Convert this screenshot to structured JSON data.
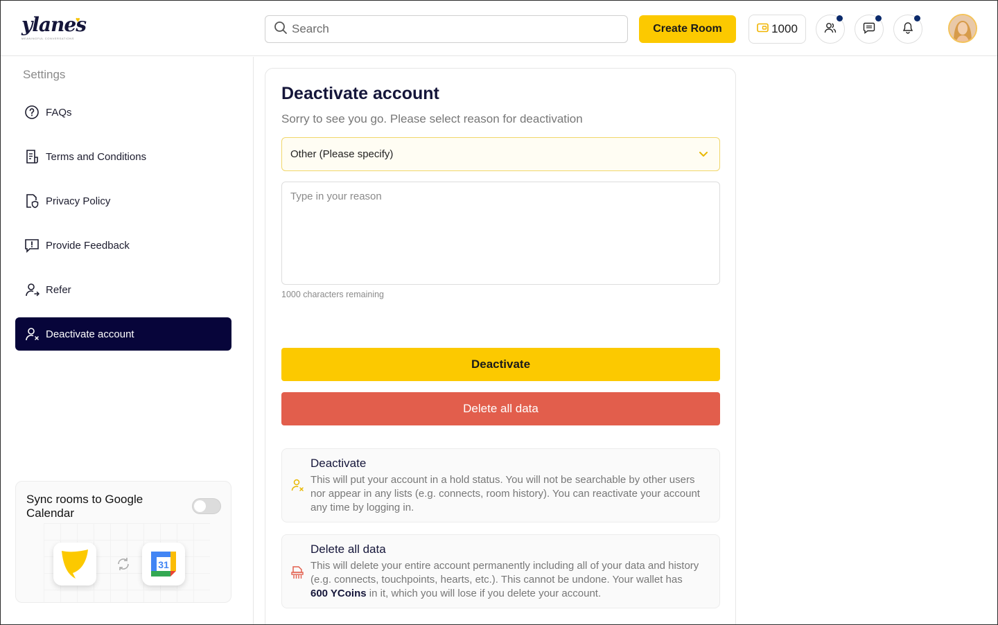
{
  "brand": {
    "name": "ylanes",
    "tagline": "MEANINGFUL CONVERSATIONS",
    "accent": "#fcc900",
    "dark": "#07053a",
    "danger": "#e25e4c"
  },
  "header": {
    "search_placeholder": "Search",
    "create_room_label": "Create Room",
    "coins": "1000",
    "icons": [
      "people-icon",
      "chat-icon",
      "bell-icon"
    ]
  },
  "sidebar": {
    "title": "Settings",
    "items": [
      {
        "label": "FAQs",
        "icon": "help-circle-icon"
      },
      {
        "label": "Terms and Conditions",
        "icon": "document-icon"
      },
      {
        "label": "Privacy Policy",
        "icon": "privacy-doc-icon"
      },
      {
        "label": "Provide Feedback",
        "icon": "feedback-icon"
      },
      {
        "label": "Refer",
        "icon": "refer-user-icon"
      },
      {
        "label": "Deactivate account",
        "icon": "user-remove-icon",
        "active": true
      }
    ],
    "sync": {
      "label": "Sync rooms to Google Calendar",
      "enabled": false,
      "calendar_day": "31"
    }
  },
  "main": {
    "title": "Deactivate account",
    "subtitle": "Sorry to see you go. Please select reason for deactivation",
    "reason_selected": "Other (Please specify)",
    "reason_placeholder": "Type in your reason",
    "remaining": "1000 characters remaining",
    "deactivate_label": "Deactivate",
    "delete_label": "Delete all data",
    "info": [
      {
        "title": "Deactivate",
        "desc": "This will put your account in a hold status. You will not be searchable by other users nor appear in any lists (e.g. connects, room history). You can reactivate your account any time by logging in."
      },
      {
        "title": "Delete all data",
        "desc_before": "This will delete your entire account permanently including all of your data and history (e.g. connects, touchpoints, hearts, etc.). This cannot be undone. Your wallet has",
        "desc_bold": "600 YCoins",
        "desc_after": "in it, which you will lose if you delete your account."
      }
    ]
  }
}
